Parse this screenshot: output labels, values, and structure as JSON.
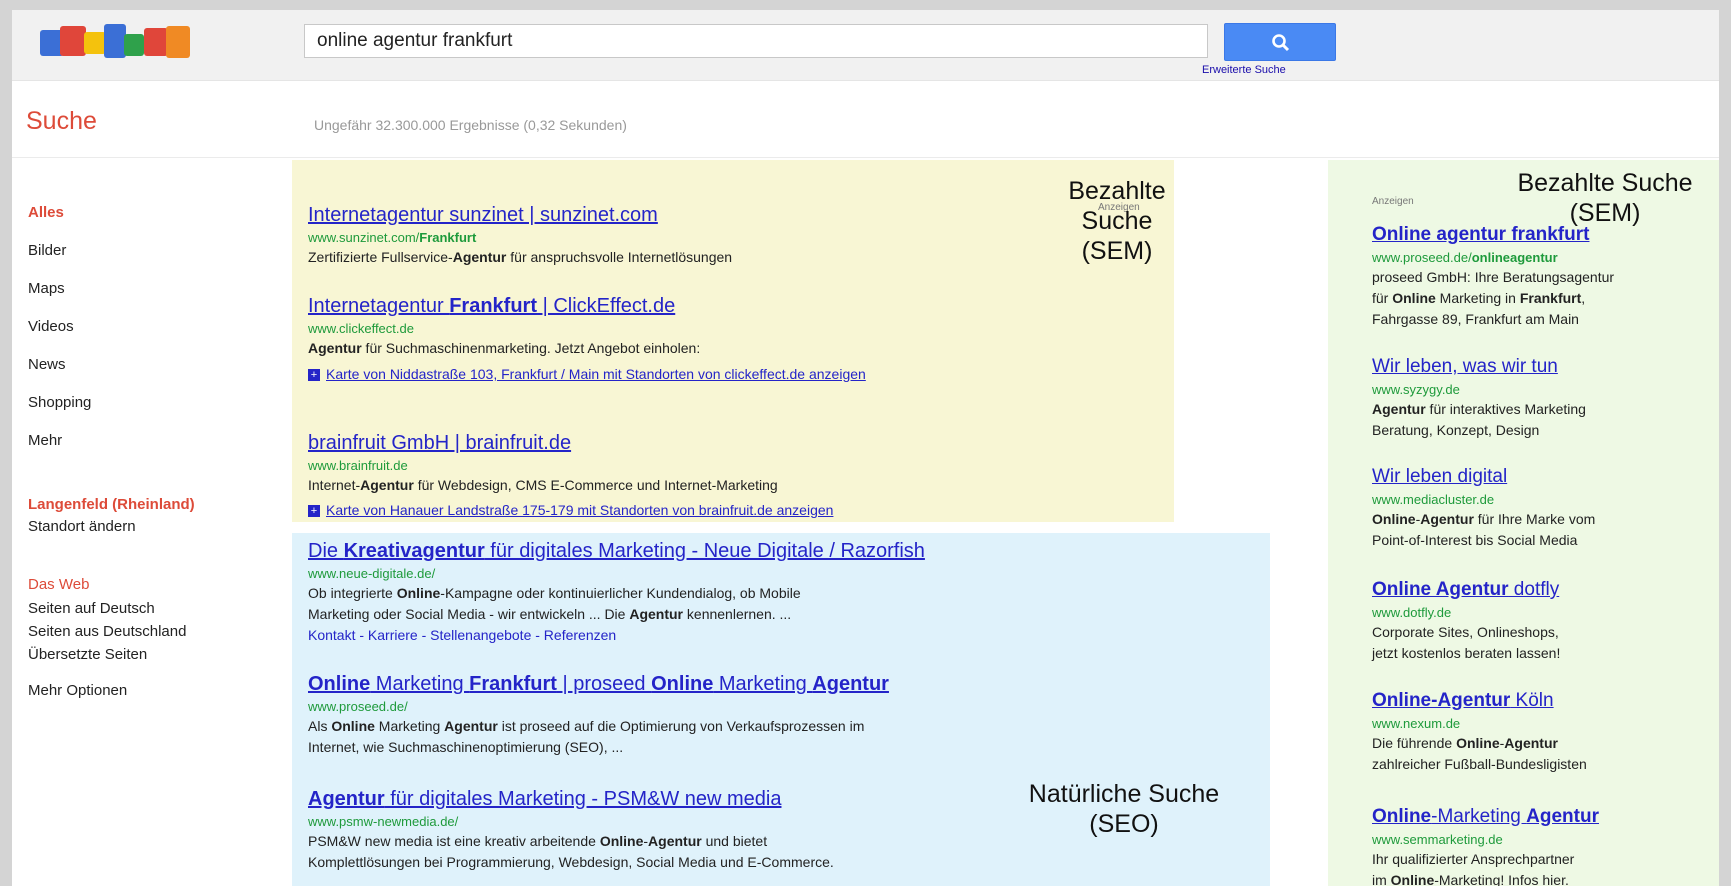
{
  "header": {
    "search_value": "online agentur frankfurt",
    "advanced_search": "Erweiterte Suche"
  },
  "resultbar": {
    "title": "Suche",
    "stats": "Ungefähr 32.300.000 Ergebnisse (0,32 Sekunden)"
  },
  "leftnav": {
    "items": [
      "Alles",
      "Bilder",
      "Maps",
      "Videos",
      "News",
      "Shopping",
      "Mehr"
    ],
    "location": "Langenfeld (Rheinland)",
    "change_location": "Standort ändern",
    "web_heading": "Das Web",
    "web_options": [
      "Seiten auf Deutsch",
      "Seiten aus Deutschland",
      "Übersetzte Seiten"
    ],
    "more_options": "Mehr Optionen"
  },
  "top_ads": {
    "label": "Anzeigen",
    "items": [
      {
        "title": "Internetagentur sunzinet | sunzinet.com",
        "url_a": "www.sunzinet.com/",
        "url_b": "Frankfurt",
        "snip_a": "Zertifizierte Fullservice-",
        "snip_b": "Agentur",
        "snip_c": " für anspruchsvolle Internetlösungen"
      },
      {
        "title_a": "Internetagentur ",
        "title_b": "Frankfurt",
        "title_c": " | ClickEffect.de",
        "url": "www.clickeffect.de",
        "snip_a": "Agentur",
        "snip_b": " für Suchmaschinenmarketing. Jetzt Angebot einholen:",
        "map_link": "Karte von Niddastraße 103, Frankfurt / Main mit Standorten von clickeffect.de anzeigen"
      },
      {
        "title": "brainfruit GmbH | brainfruit.de",
        "url": "www.brainfruit.de",
        "snip_a": "Internet-",
        "snip_b": "Agentur",
        "snip_c": " für Webdesign, CMS E-Commerce und Internet-Marketing",
        "map_link": "Karte von Hanauer Landstraße 175-179 mit Standorten von brainfruit.de anzeigen"
      }
    ]
  },
  "organic": {
    "items": [
      {
        "title_a": "Die ",
        "title_b": "Kreativagentur",
        "title_c": " für digitales Marketing - Neue Digitale / Razorfish",
        "url": "www.neue-digitale.de/",
        "snip1_a": "Ob integrierte ",
        "snip1_b": "Online",
        "snip1_c": "-Kampagne oder kontinuierlicher Kundendialog, ob Mobile",
        "snip2_a": "Marketing oder Social Media - wir entwickeln ... Die ",
        "snip2_b": "Agentur",
        "snip2_c": " kennenlernen. ...",
        "sitelinks": "Kontakt - Karriere - Stellenangebote - Referenzen"
      },
      {
        "title_a": "Online",
        "title_b": " Marketing ",
        "title_c": "Frankfurt",
        "title_d": " | proseed ",
        "title_e": "Online",
        "title_f": " Marketing ",
        "title_g": "Agentur",
        "url": "www.proseed.de/",
        "snip1_a": "Als ",
        "snip1_b": "Online",
        "snip1_c": " Marketing ",
        "snip1_d": "Agentur",
        "snip1_e": " ist proseed auf die Optimierung von Verkaufsprozessen im",
        "snip2": "Internet, wie Suchmaschinenoptimierung (SEO), ..."
      },
      {
        "title_a": "Agentur",
        "title_b": " für digitales Marketing - PSM&W new media",
        "url": "www.psmw-newmedia.de/",
        "snip1_a": "PSM&W new media ist eine kreativ arbeitende ",
        "snip1_b": "Online",
        "snip1_c": "-",
        "snip1_d": "Agentur",
        "snip1_e": " und bietet",
        "snip2": "Komplettlösungen bei Programmierung, Webdesign, Social Media und E-Commerce."
      }
    ]
  },
  "right_ads": {
    "label": "Anzeigen",
    "items": [
      {
        "title": "Online agentur frankfurt",
        "url_a": "www.proseed.de/",
        "url_b": "onlineagentur",
        "l1": "proseed GmbH: Ihre Beratungsagentur",
        "l2_a": "für ",
        "l2_b": "Online",
        "l2_c": " Marketing in ",
        "l2_d": "Frankfurt",
        "l2_e": ",",
        "l3": "Fahrgasse 89, Frankfurt am Main"
      },
      {
        "title": "Wir leben, was wir tun",
        "url": "www.syzygy.de",
        "l1_a": "Agentur",
        "l1_b": " für interaktives Marketing",
        "l2": "Beratung, Konzept, Design"
      },
      {
        "title": "Wir leben digital",
        "url": "www.mediacluster.de",
        "l1_a": "Online",
        "l1_b": "-",
        "l1_c": "Agentur",
        "l1_d": " für Ihre Marke vom",
        "l2": "Point-of-Interest bis Social Media"
      },
      {
        "title_a": "Online Agentur",
        "title_b": " dotfly",
        "url": "www.dotfly.de",
        "l1": "Corporate Sites, Onlineshops,",
        "l2": "jetzt kostenlos beraten lassen!"
      },
      {
        "title_a": "Online-Agentur",
        "title_b": " Köln",
        "url": "www.nexum.de",
        "l1_a": "Die führende ",
        "l1_b": "Online",
        "l1_c": "-",
        "l1_d": "Agentur",
        "l2": "zahlreicher Fußball-Bundesligisten"
      },
      {
        "title_a": "Online",
        "title_b": "-Marketing ",
        "title_c": "Agentur",
        "url": "www.semmarketing.de",
        "l1": "Ihr qualifizierter Ansprechpartner",
        "l2_a": "im ",
        "l2_b": "Online",
        "l2_c": "-Marketing! Infos hier."
      }
    ]
  },
  "overlays": {
    "paid_center": [
      "Bezahlte Suche",
      "(SEM)"
    ],
    "paid_right": [
      "Bezahlte Suche",
      "(SEM)"
    ],
    "natural": [
      "Natürliche Suche",
      "(SEO)"
    ]
  },
  "colors": {
    "ad_background": "#f8f6d4",
    "organic_background": "#dff2fb",
    "right_ad_background": "#eef9e4",
    "link": "#2424c8",
    "url_green": "#1e9a3b",
    "accent_red": "#dd4b39",
    "search_button": "#4a8af4"
  },
  "icons": {
    "search_button": "magnifier-icon",
    "map_expand": "plus-box-icon"
  }
}
